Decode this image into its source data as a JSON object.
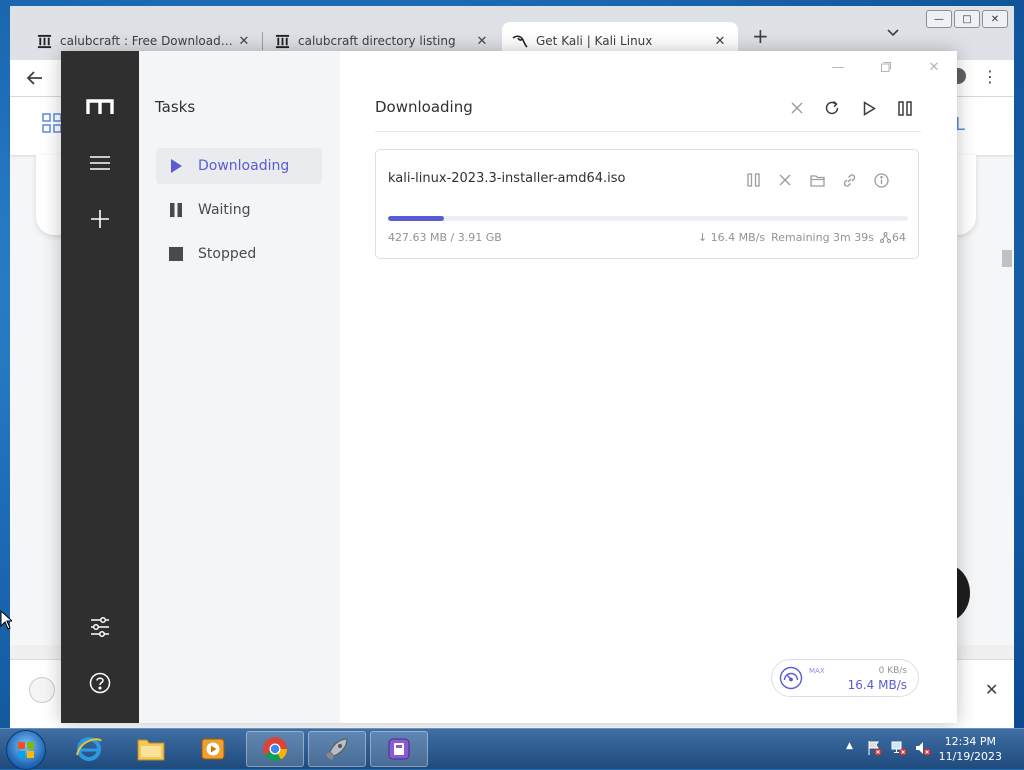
{
  "browser": {
    "tabs": [
      {
        "title": "calubcraft : Free Download, Borrow",
        "icon": "archive-icon",
        "active": false
      },
      {
        "title": "calubcraft directory listing",
        "icon": "archive-icon",
        "active": false
      },
      {
        "title": "Get Kali | Kali Linux",
        "icon": "kali-dragon-icon",
        "active": true
      }
    ],
    "new_tab_symbol": "+",
    "page_partial_letter": "L"
  },
  "app": {
    "subnav": {
      "title": "Tasks",
      "items": [
        {
          "label": "Downloading",
          "icon": "play-icon",
          "active": true
        },
        {
          "label": "Waiting",
          "icon": "pause-icon",
          "active": false
        },
        {
          "label": "Stopped",
          "icon": "stop-icon",
          "active": false
        }
      ]
    },
    "main": {
      "title": "Downloading",
      "task": {
        "name": "kali-linux-2023.3-installer-amd64.iso",
        "progress_percent": 10.7,
        "size_text": "427.63 MB / 3.91 GB",
        "speed": "16.4 MB/s",
        "remaining": "Remaining 3m 39s",
        "connections": "64"
      },
      "speedometer": {
        "max_label": "MAX",
        "upload": "0 KB/s",
        "download": "16.4 MB/s"
      }
    }
  },
  "taskbar": {
    "time": "12:34 PM",
    "date": "11/19/2023"
  },
  "colors": {
    "accent": "#5b5bd6",
    "sidebar": "#2f2f2f"
  }
}
